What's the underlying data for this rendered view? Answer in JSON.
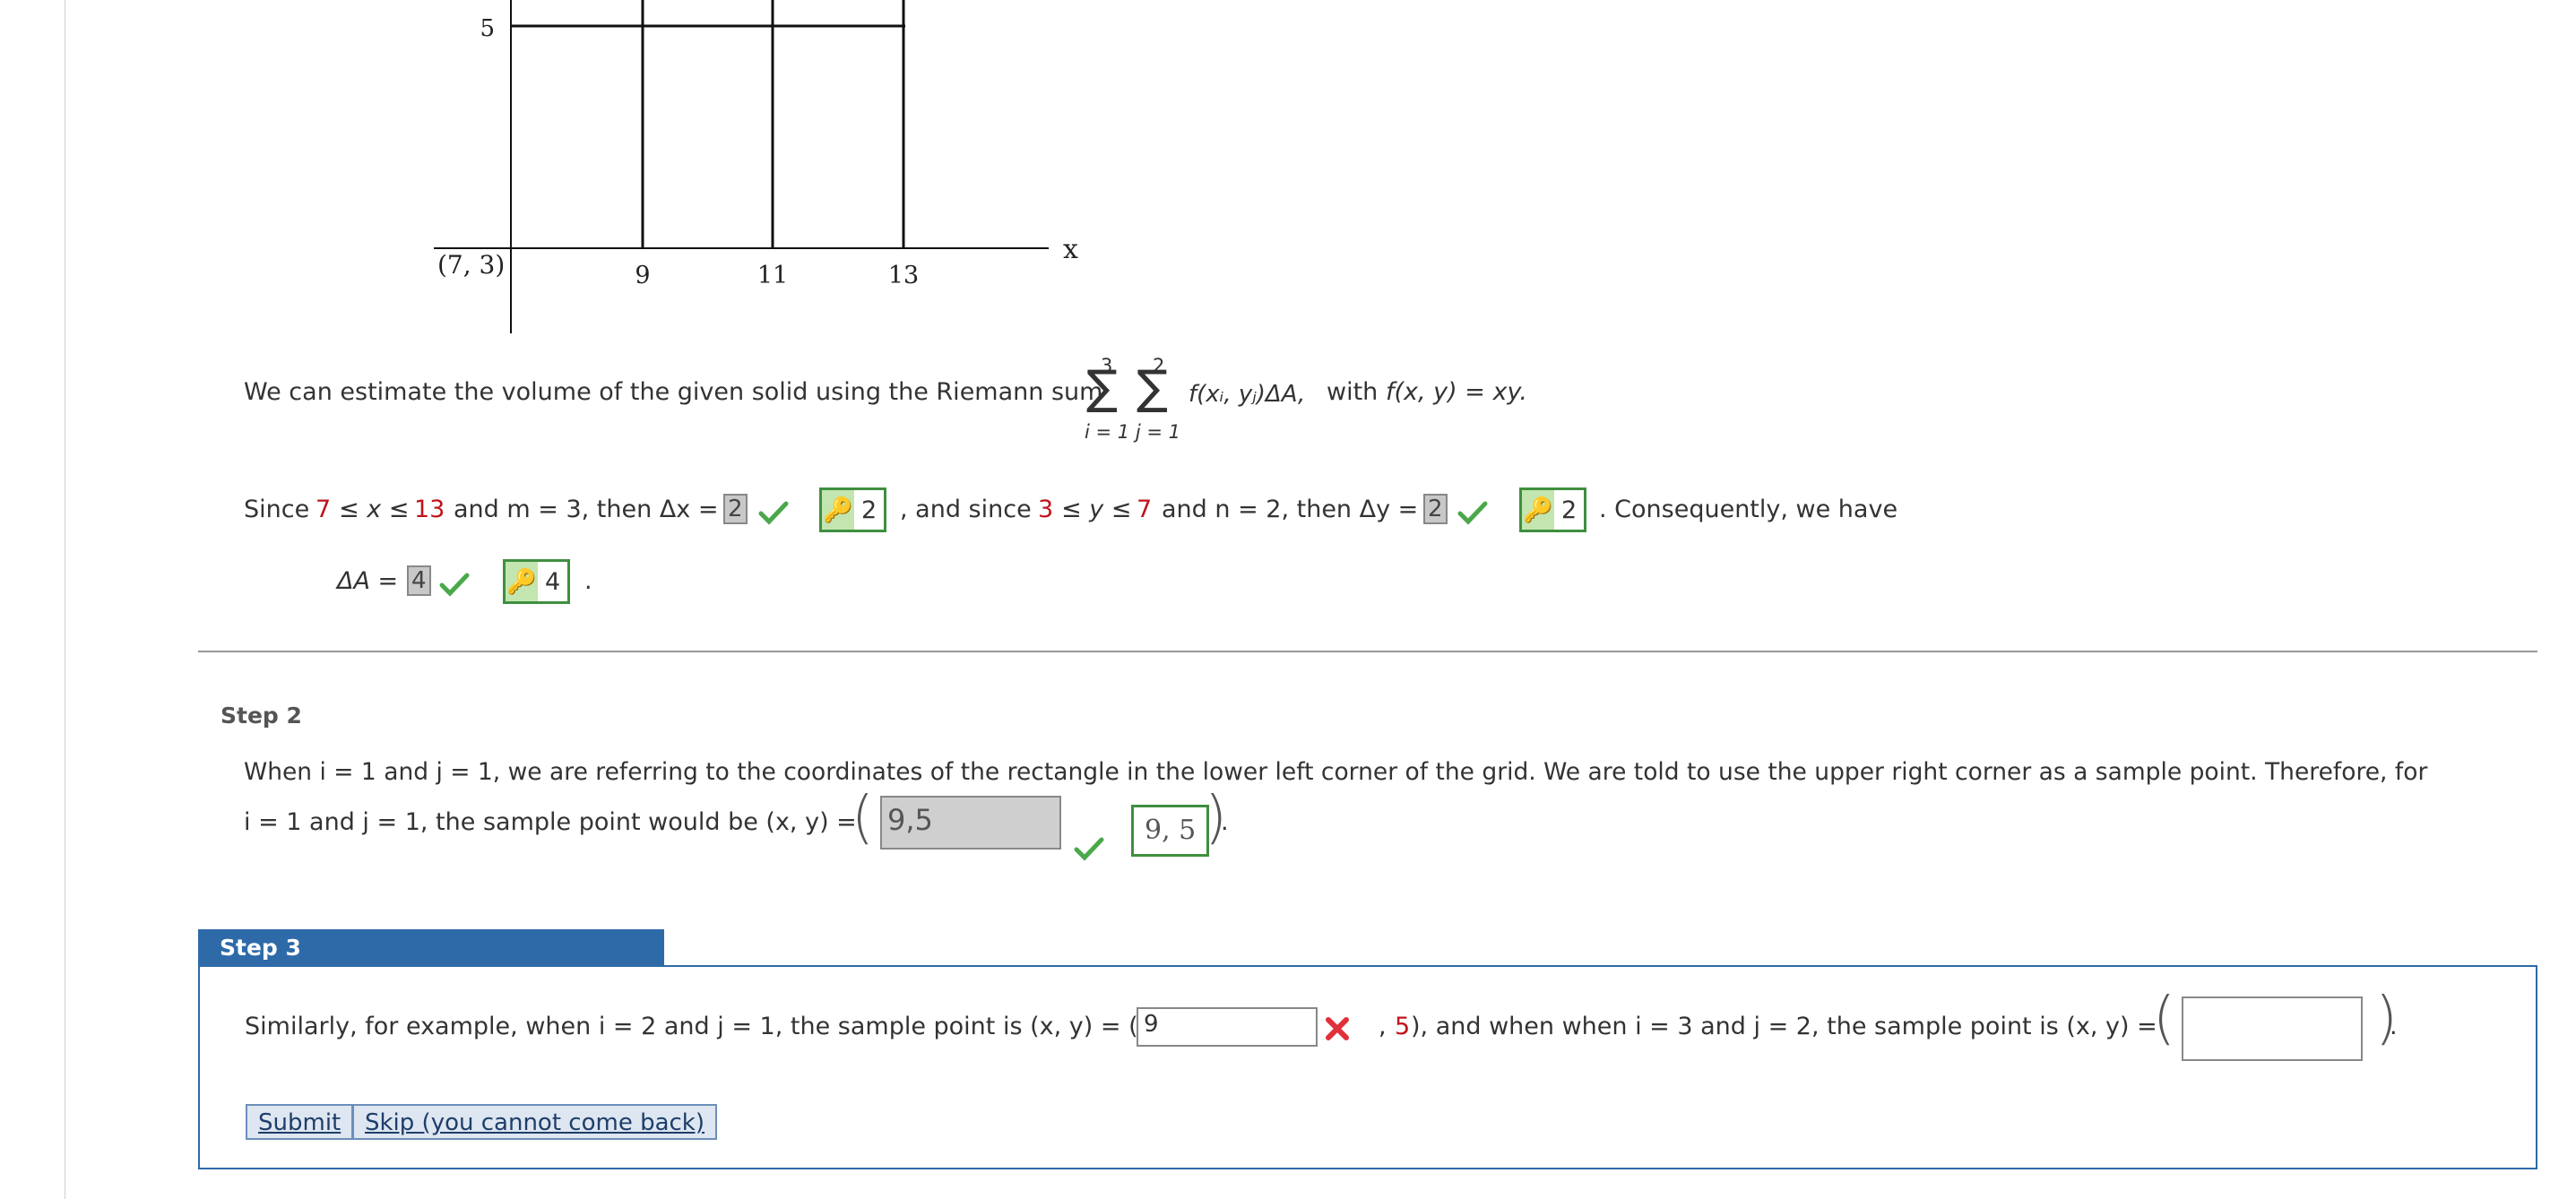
{
  "graph": {
    "y_tick": "5",
    "origin_label": "(7, 3)",
    "x_ticks": [
      "9",
      "11",
      "13"
    ],
    "x_axis_label": "x"
  },
  "riemann": {
    "intro": "We can estimate the volume of the given solid using the Riemann sum",
    "sum_outer_top": "3",
    "sum_inner_top": "2",
    "sum_bottom": "i = 1 j = 1",
    "summand": "f(xᵢ, yⱼ)ΔA,",
    "with_text": "with",
    "func_def": "f(x, y) = xy."
  },
  "step1": {
    "since": "Since",
    "x_low": "7",
    "x_mid": "≤ x ≤",
    "x_high": "13",
    "m_text": "and m = 3, then Δx =",
    "dx_answer": "2",
    "dx_key": "2",
    "and_since": ", and since",
    "y_low": "3",
    "y_mid": "≤ y ≤",
    "y_high": "7",
    "n_text": "and n = 2, then Δy =",
    "dy_answer": "2",
    "dy_key": "2",
    "consequently": ". Consequently, we have",
    "da_label": "ΔA =",
    "da_answer": "4",
    "da_key": "4",
    "period": "."
  },
  "step2": {
    "title": "Step 2",
    "line1": "When i = 1 and j = 1, we are referring to the coordinates of the rectangle in the lower left corner of the grid. We are told to use the upper right corner as a sample point. Therefore, for",
    "line2": "i = 1 and j = 1, the sample point would be (x, y) =",
    "answer_value": "9,5",
    "key_value": "9, 5",
    "end": "."
  },
  "step3": {
    "title": "Step 3",
    "text1": "Similarly, for example, when i = 2 and j = 1, the sample point is (x, y) = (",
    "input1_value": "9",
    "comma": ",",
    "value5": "5",
    "text2": "), and when when i = 3 and j = 2, the sample point is (x, y) =",
    "input2_value": "",
    "end": ".",
    "submit_label": "Submit",
    "skip_label": "Skip (you cannot come back)"
  },
  "colors": {
    "accent": "#2e6aa8",
    "correct": "#3f8f3f",
    "wrong": "#e0303a",
    "highlight": "#c0141b"
  }
}
